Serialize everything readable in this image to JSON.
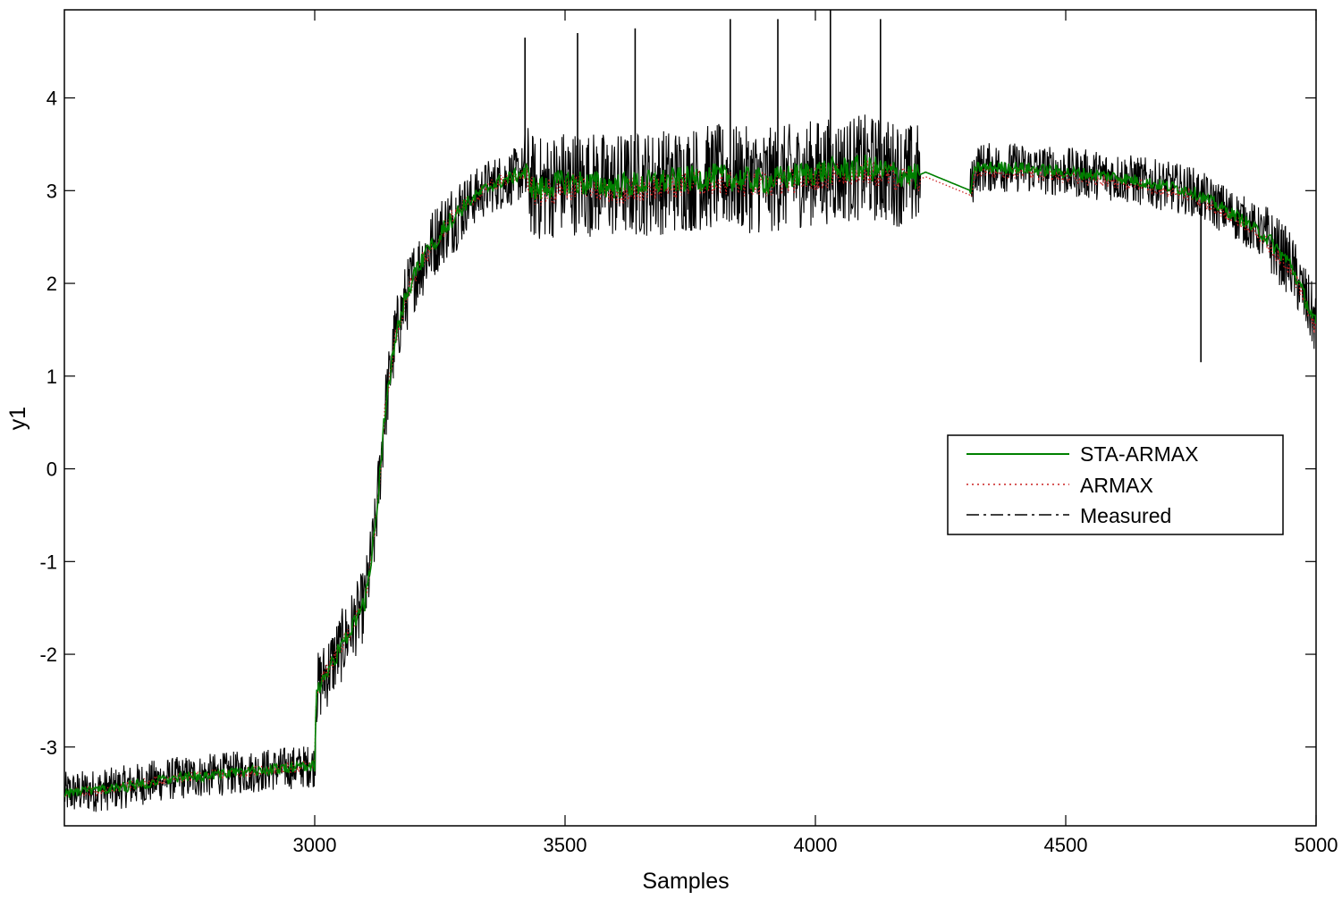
{
  "chart_data": {
    "type": "line",
    "title": "",
    "xlabel": "Samples",
    "ylabel": "y1",
    "xlim": [
      2500,
      5000
    ],
    "ylim": [
      -3.85,
      4.95
    ],
    "x_ticks": [
      3000,
      3500,
      4000,
      4500,
      5000
    ],
    "x_tick_labels": [
      "3000",
      "3500",
      "4000",
      "4500",
      "5000"
    ],
    "y_ticks": [
      -3,
      -2,
      -1,
      0,
      1,
      2,
      3,
      4
    ],
    "y_tick_labels": [
      "-3",
      "-2",
      "-1",
      "0",
      "1",
      "2",
      "3",
      "4"
    ],
    "grid": false,
    "legend_position": "middle-right",
    "x": [
      2500,
      2600,
      2700,
      2800,
      2900,
      3000,
      3003,
      3050,
      3100,
      3120,
      3140,
      3160,
      3180,
      3200,
      3250,
      3300,
      3350,
      3420,
      3440,
      3500,
      3600,
      3700,
      3800,
      3900,
      4000,
      4100,
      4150,
      4200,
      4220,
      4310,
      4320,
      4400,
      4500,
      4600,
      4700,
      4750,
      4800,
      4850,
      4900,
      4950,
      5000
    ],
    "series": [
      {
        "name": "STA-ARMAX",
        "color": "#008000",
        "style": "solid",
        "values": [
          -3.5,
          -3.45,
          -3.35,
          -3.3,
          -3.25,
          -3.2,
          -2.4,
          -1.95,
          -1.45,
          -0.7,
          0.6,
          1.4,
          1.8,
          2.1,
          2.55,
          2.85,
          3.05,
          3.2,
          3.0,
          3.1,
          3.05,
          3.1,
          3.15,
          3.1,
          3.2,
          3.25,
          3.2,
          3.15,
          3.2,
          3.0,
          3.25,
          3.25,
          3.2,
          3.15,
          3.05,
          3.0,
          2.85,
          2.7,
          2.5,
          2.2,
          1.55
        ]
      },
      {
        "name": "ARMAX",
        "color": "#cc2222",
        "style": "dotted",
        "values": [
          -3.5,
          -3.45,
          -3.35,
          -3.3,
          -3.25,
          -3.2,
          -2.4,
          -1.95,
          -1.45,
          -0.7,
          0.6,
          1.4,
          1.8,
          2.1,
          2.55,
          2.85,
          3.05,
          3.2,
          2.95,
          3.05,
          3.0,
          3.05,
          3.1,
          3.05,
          3.15,
          3.2,
          3.15,
          3.1,
          3.15,
          2.95,
          3.2,
          3.2,
          3.15,
          3.1,
          3.0,
          2.95,
          2.8,
          2.65,
          2.45,
          2.15,
          1.5
        ]
      },
      {
        "name": "Measured",
        "color": "#000000",
        "style": "dashdot",
        "values": [
          -3.5,
          -3.45,
          -3.35,
          -3.3,
          -3.25,
          -3.2,
          -2.4,
          -1.95,
          -1.45,
          -0.7,
          0.6,
          1.4,
          1.8,
          2.1,
          2.55,
          2.85,
          3.05,
          3.2,
          3.0,
          3.1,
          3.05,
          3.1,
          3.15,
          3.1,
          3.2,
          3.25,
          3.2,
          3.15,
          3.2,
          3.0,
          3.25,
          3.25,
          3.2,
          3.15,
          3.05,
          3.0,
          2.85,
          2.7,
          2.5,
          2.2,
          1.55
        ]
      }
    ],
    "spikes": [
      {
        "x": 3420,
        "y": 4.65
      },
      {
        "x": 3525,
        "y": 4.7
      },
      {
        "x": 3640,
        "y": 4.75
      },
      {
        "x": 3830,
        "y": 4.85
      },
      {
        "x": 3925,
        "y": 4.85
      },
      {
        "x": 4030,
        "y": 4.95
      },
      {
        "x": 4130,
        "y": 4.85
      },
      {
        "x": 4770,
        "y": 1.15
      }
    ]
  }
}
